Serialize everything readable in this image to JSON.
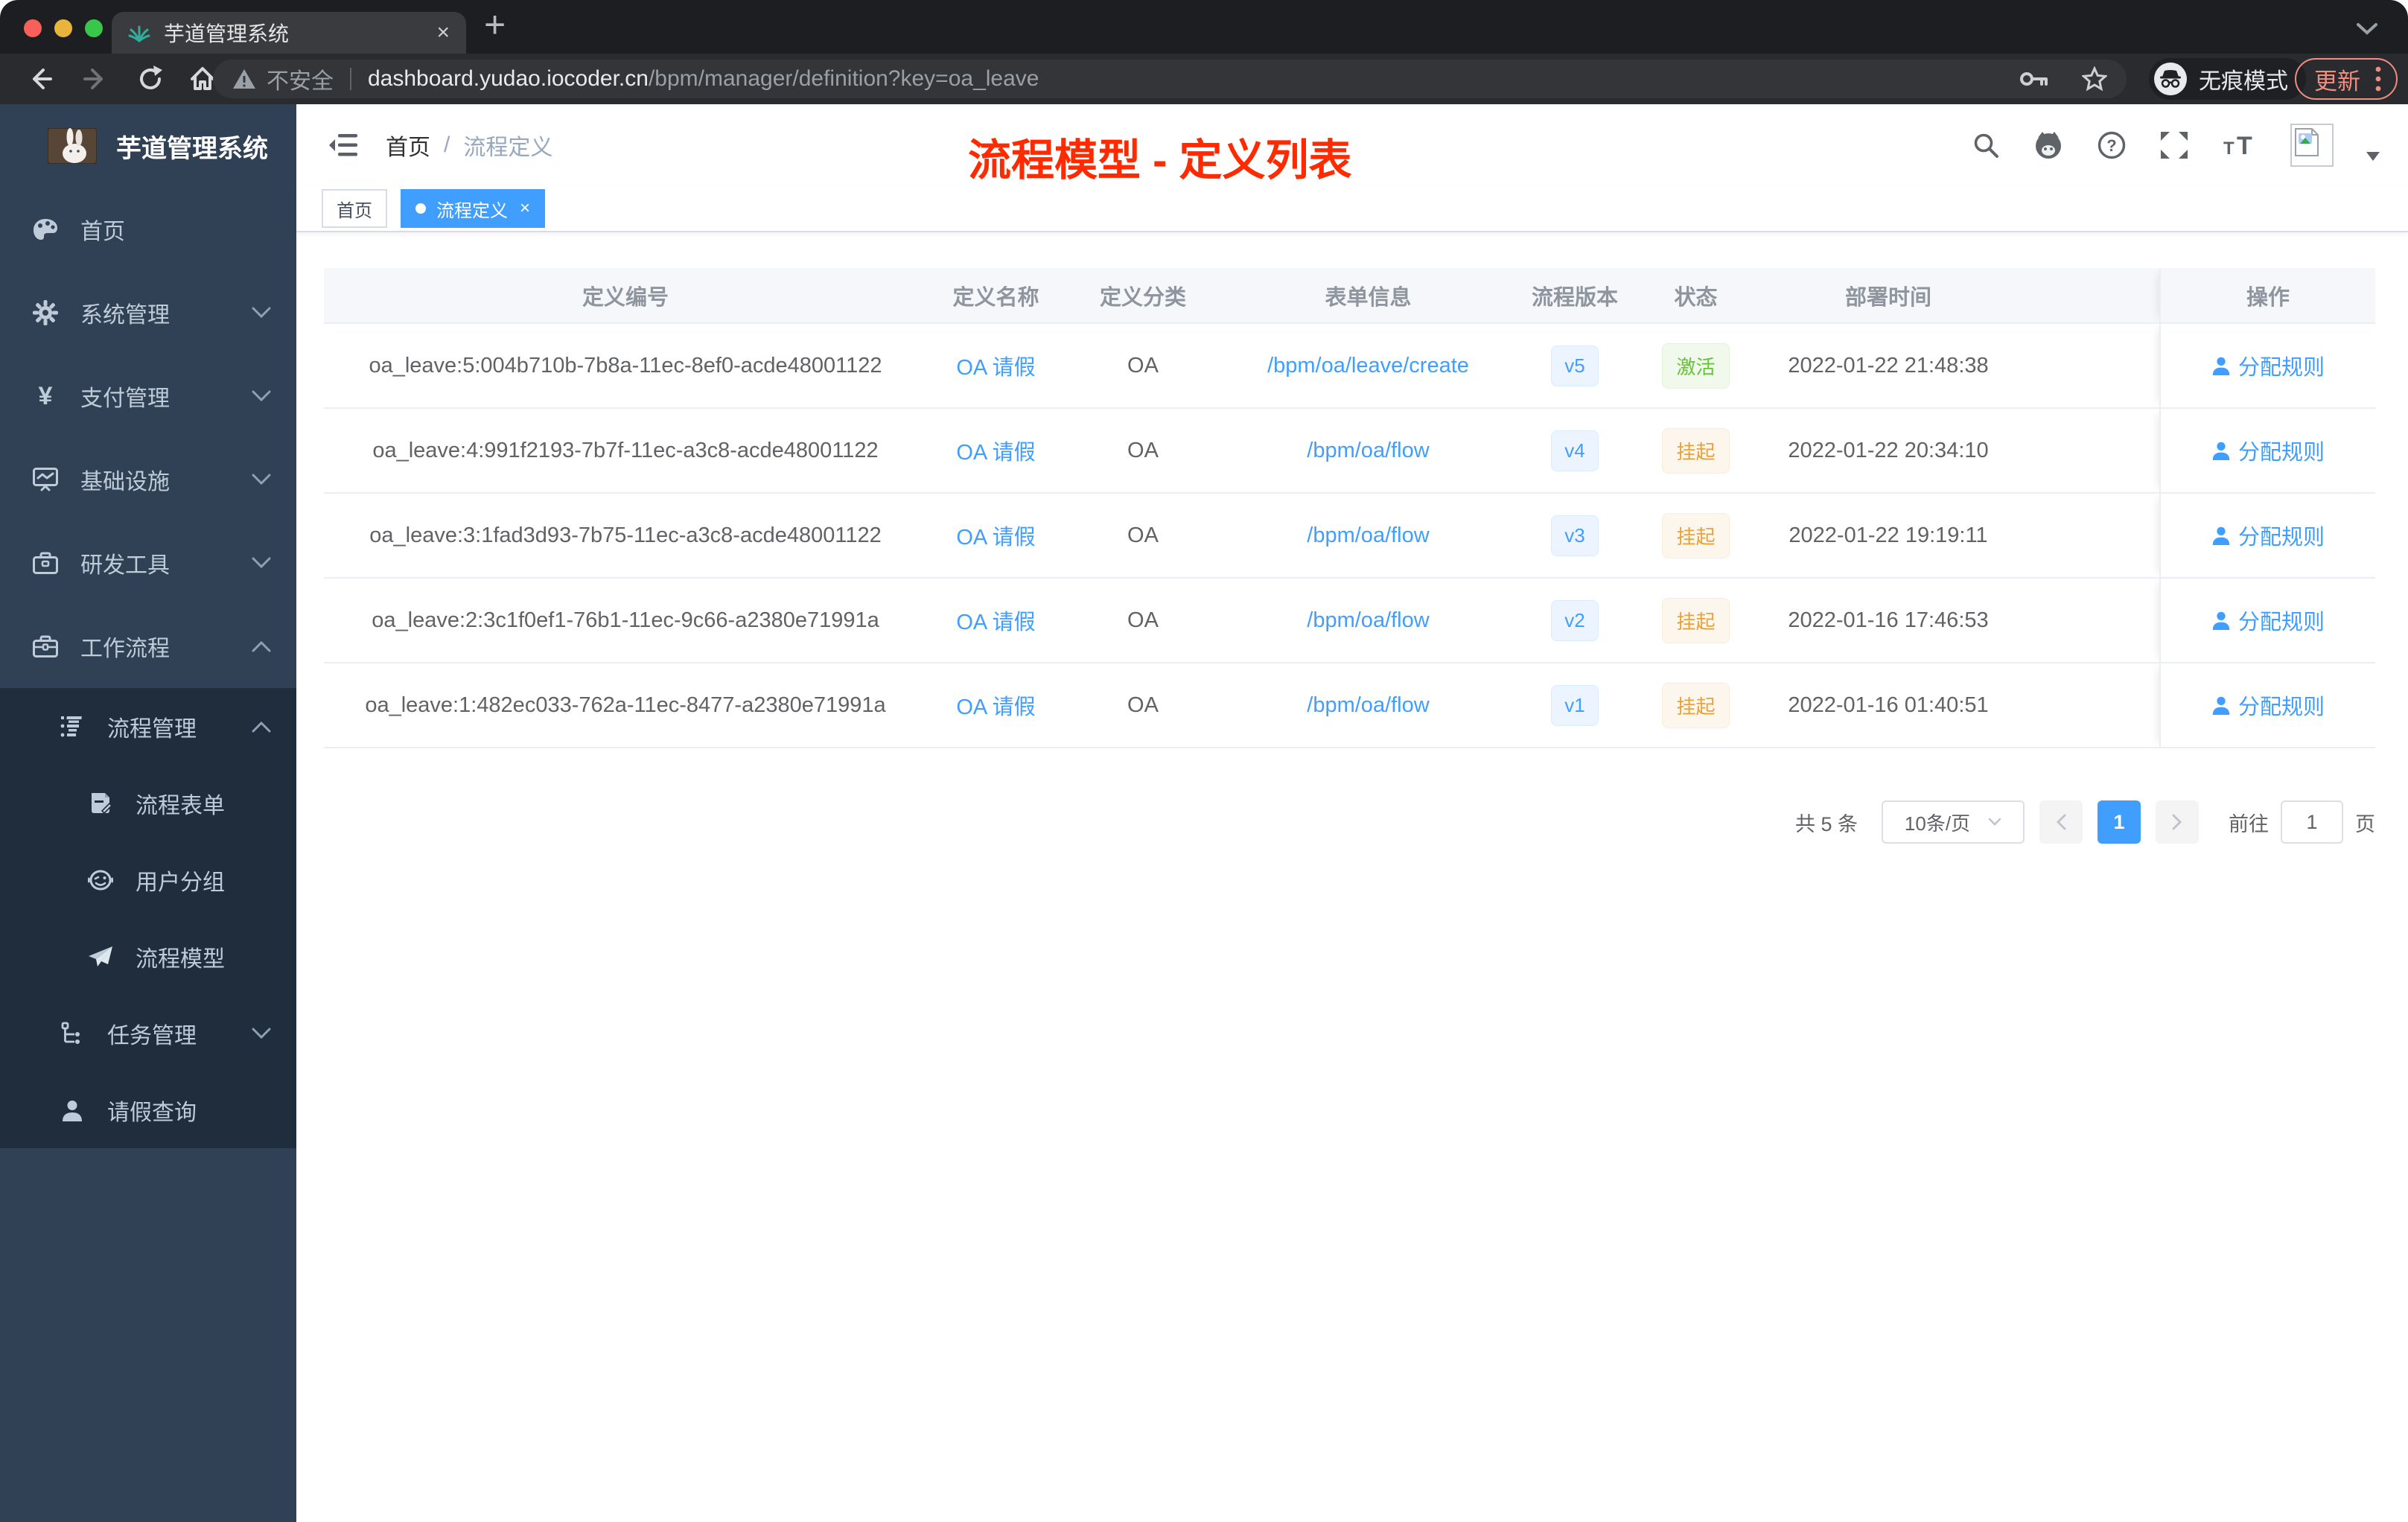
{
  "browser": {
    "tab_title": "芋道管理系统",
    "security_label": "不安全",
    "url_domain": "dashboard.yudao.iocoder.cn",
    "url_path": "/bpm/manager/definition?key=oa_leave",
    "incognito_label": "无痕模式",
    "update_label": "更新"
  },
  "icons": {
    "close_glyph": "×",
    "plus_glyph": "+",
    "yen_glyph": "¥",
    "font_size_glyph": "tT",
    "help_glyph": "?"
  },
  "sidebar": {
    "app_title": "芋道管理系统",
    "items": [
      {
        "label": "首页",
        "icon": "dashboard-icon"
      },
      {
        "label": "系统管理",
        "icon": "gear-icon"
      },
      {
        "label": "支付管理",
        "icon": "yen-icon"
      },
      {
        "label": "基础设施",
        "icon": "monitor-icon"
      },
      {
        "label": "研发工具",
        "icon": "toolbox-icon"
      },
      {
        "label": "工作流程",
        "icon": "briefcase-icon"
      }
    ],
    "submenu": [
      {
        "label": "流程管理",
        "icon": "list-icon"
      },
      {
        "label": "流程表单",
        "icon": "form-icon"
      },
      {
        "label": "用户分组",
        "icon": "robot-icon"
      },
      {
        "label": "流程模型",
        "icon": "paper-plane-icon"
      },
      {
        "label": "任务管理",
        "icon": "tree-icon"
      },
      {
        "label": "请假查询",
        "icon": "user-icon"
      }
    ]
  },
  "navbar": {
    "breadcrumb_home": "首页",
    "breadcrumb_separator": "/",
    "breadcrumb_current": "流程定义",
    "annotation_title": "流程模型 - 定义列表"
  },
  "tags": {
    "home": "首页",
    "active": "流程定义"
  },
  "table": {
    "columns": [
      "定义编号",
      "定义名称",
      "定义分类",
      "表单信息",
      "流程版本",
      "状态",
      "部署时间",
      "操作"
    ],
    "rows": [
      {
        "id": "oa_leave:5:004b710b-7b8a-11ec-8ef0-acde48001122",
        "name": "OA 请假",
        "category": "OA",
        "form": "/bpm/oa/leave/create",
        "version": "v5",
        "status": "激活",
        "status_type": "success",
        "time": "2022-01-22 21:48:38",
        "action": "分配规则"
      },
      {
        "id": "oa_leave:4:991f2193-7b7f-11ec-a3c8-acde48001122",
        "name": "OA 请假",
        "category": "OA",
        "form": "/bpm/oa/flow",
        "version": "v4",
        "status": "挂起",
        "status_type": "warning",
        "time": "2022-01-22 20:34:10",
        "action": "分配规则"
      },
      {
        "id": "oa_leave:3:1fad3d93-7b75-11ec-a3c8-acde48001122",
        "name": "OA 请假",
        "category": "OA",
        "form": "/bpm/oa/flow",
        "version": "v3",
        "status": "挂起",
        "status_type": "warning",
        "time": "2022-01-22 19:19:11",
        "action": "分配规则"
      },
      {
        "id": "oa_leave:2:3c1f0ef1-76b1-11ec-9c66-a2380e71991a",
        "name": "OA 请假",
        "category": "OA",
        "form": "/bpm/oa/flow",
        "version": "v2",
        "status": "挂起",
        "status_type": "warning",
        "time": "2022-01-16 17:46:53",
        "action": "分配规则"
      },
      {
        "id": "oa_leave:1:482ec033-762a-11ec-8477-a2380e71991a",
        "name": "OA 请假",
        "category": "OA",
        "form": "/bpm/oa/flow",
        "version": "v1",
        "status": "挂起",
        "status_type": "warning",
        "time": "2022-01-16 01:40:51",
        "action": "分配规则"
      }
    ]
  },
  "pagination": {
    "total": "共 5 条",
    "page_size": "10条/页",
    "current_page": "1",
    "goto_label": "前往",
    "goto_value": "1",
    "unit_label": "页"
  },
  "colors": {
    "accent": "#409eff",
    "annotation_red": "#ff2a00",
    "success_green": "#67c23a",
    "warning_orange": "#e6a23c",
    "sidebar_bg": "#304156",
    "submenu_bg": "#1f2d3d"
  }
}
